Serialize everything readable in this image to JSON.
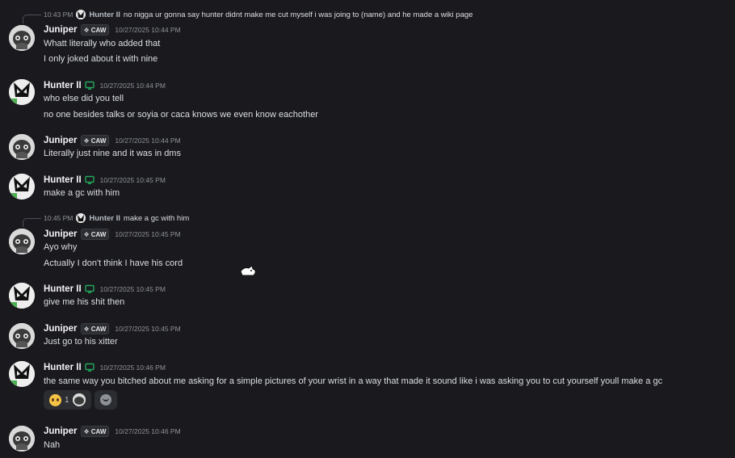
{
  "reply1": {
    "time": "10:43 PM",
    "author": "Hunter II",
    "text": "no nigga ur gonna say hunter didnt make me cut myself i was joing to  (name) and he made a wiki page"
  },
  "reply2": {
    "time": "10:45 PM",
    "author": "Hunter II",
    "text": "make a gc with him"
  },
  "tag_label": "CAW",
  "messages": [
    {
      "author": "Juniper",
      "time": "10/27/2025 10:44 PM",
      "lines": [
        "Whatt literally who added that",
        "I only joked about it with nine"
      ]
    },
    {
      "author": "Hunter II",
      "time": "10/27/2025 10:44 PM",
      "lines": [
        "who else did you tell",
        "no one besides talks or soyia or caca knows we even know eachother"
      ]
    },
    {
      "author": "Juniper",
      "time": "10/27/2025 10:44 PM",
      "lines": [
        "Literally just nine and it was in dms"
      ]
    },
    {
      "author": "Hunter II",
      "time": "10/27/2025 10:45 PM",
      "lines": [
        "make a gc with him"
      ]
    },
    {
      "author": "Juniper",
      "time": "10/27/2025 10:45 PM",
      "lines": [
        "Ayo why",
        "Actually I don't think I have his cord"
      ]
    },
    {
      "author": "Hunter II",
      "time": "10/27/2025 10:45 PM",
      "lines": [
        "give me his shit then"
      ]
    },
    {
      "author": "Juniper",
      "time": "10/27/2025 10:45 PM",
      "lines": [
        "Just go to his xitter"
      ]
    },
    {
      "author": "Hunter II",
      "time": "10/27/2025 10:46 PM",
      "lines": [
        "the same way you bitched about me asking for a simple pictures of your wrist in a way that made it sound like i was asking you to cut yourself youll make a gc"
      ]
    },
    {
      "author": "Juniper",
      "time": "10/27/2025 10:46 PM",
      "lines": [
        "Nah"
      ]
    }
  ],
  "reaction": {
    "emoji": "pleading-face",
    "count": "1"
  },
  "colors": {
    "background": "#1a1a1e",
    "device_icon": "#23a55a",
    "timestamp": "#8e9297"
  }
}
